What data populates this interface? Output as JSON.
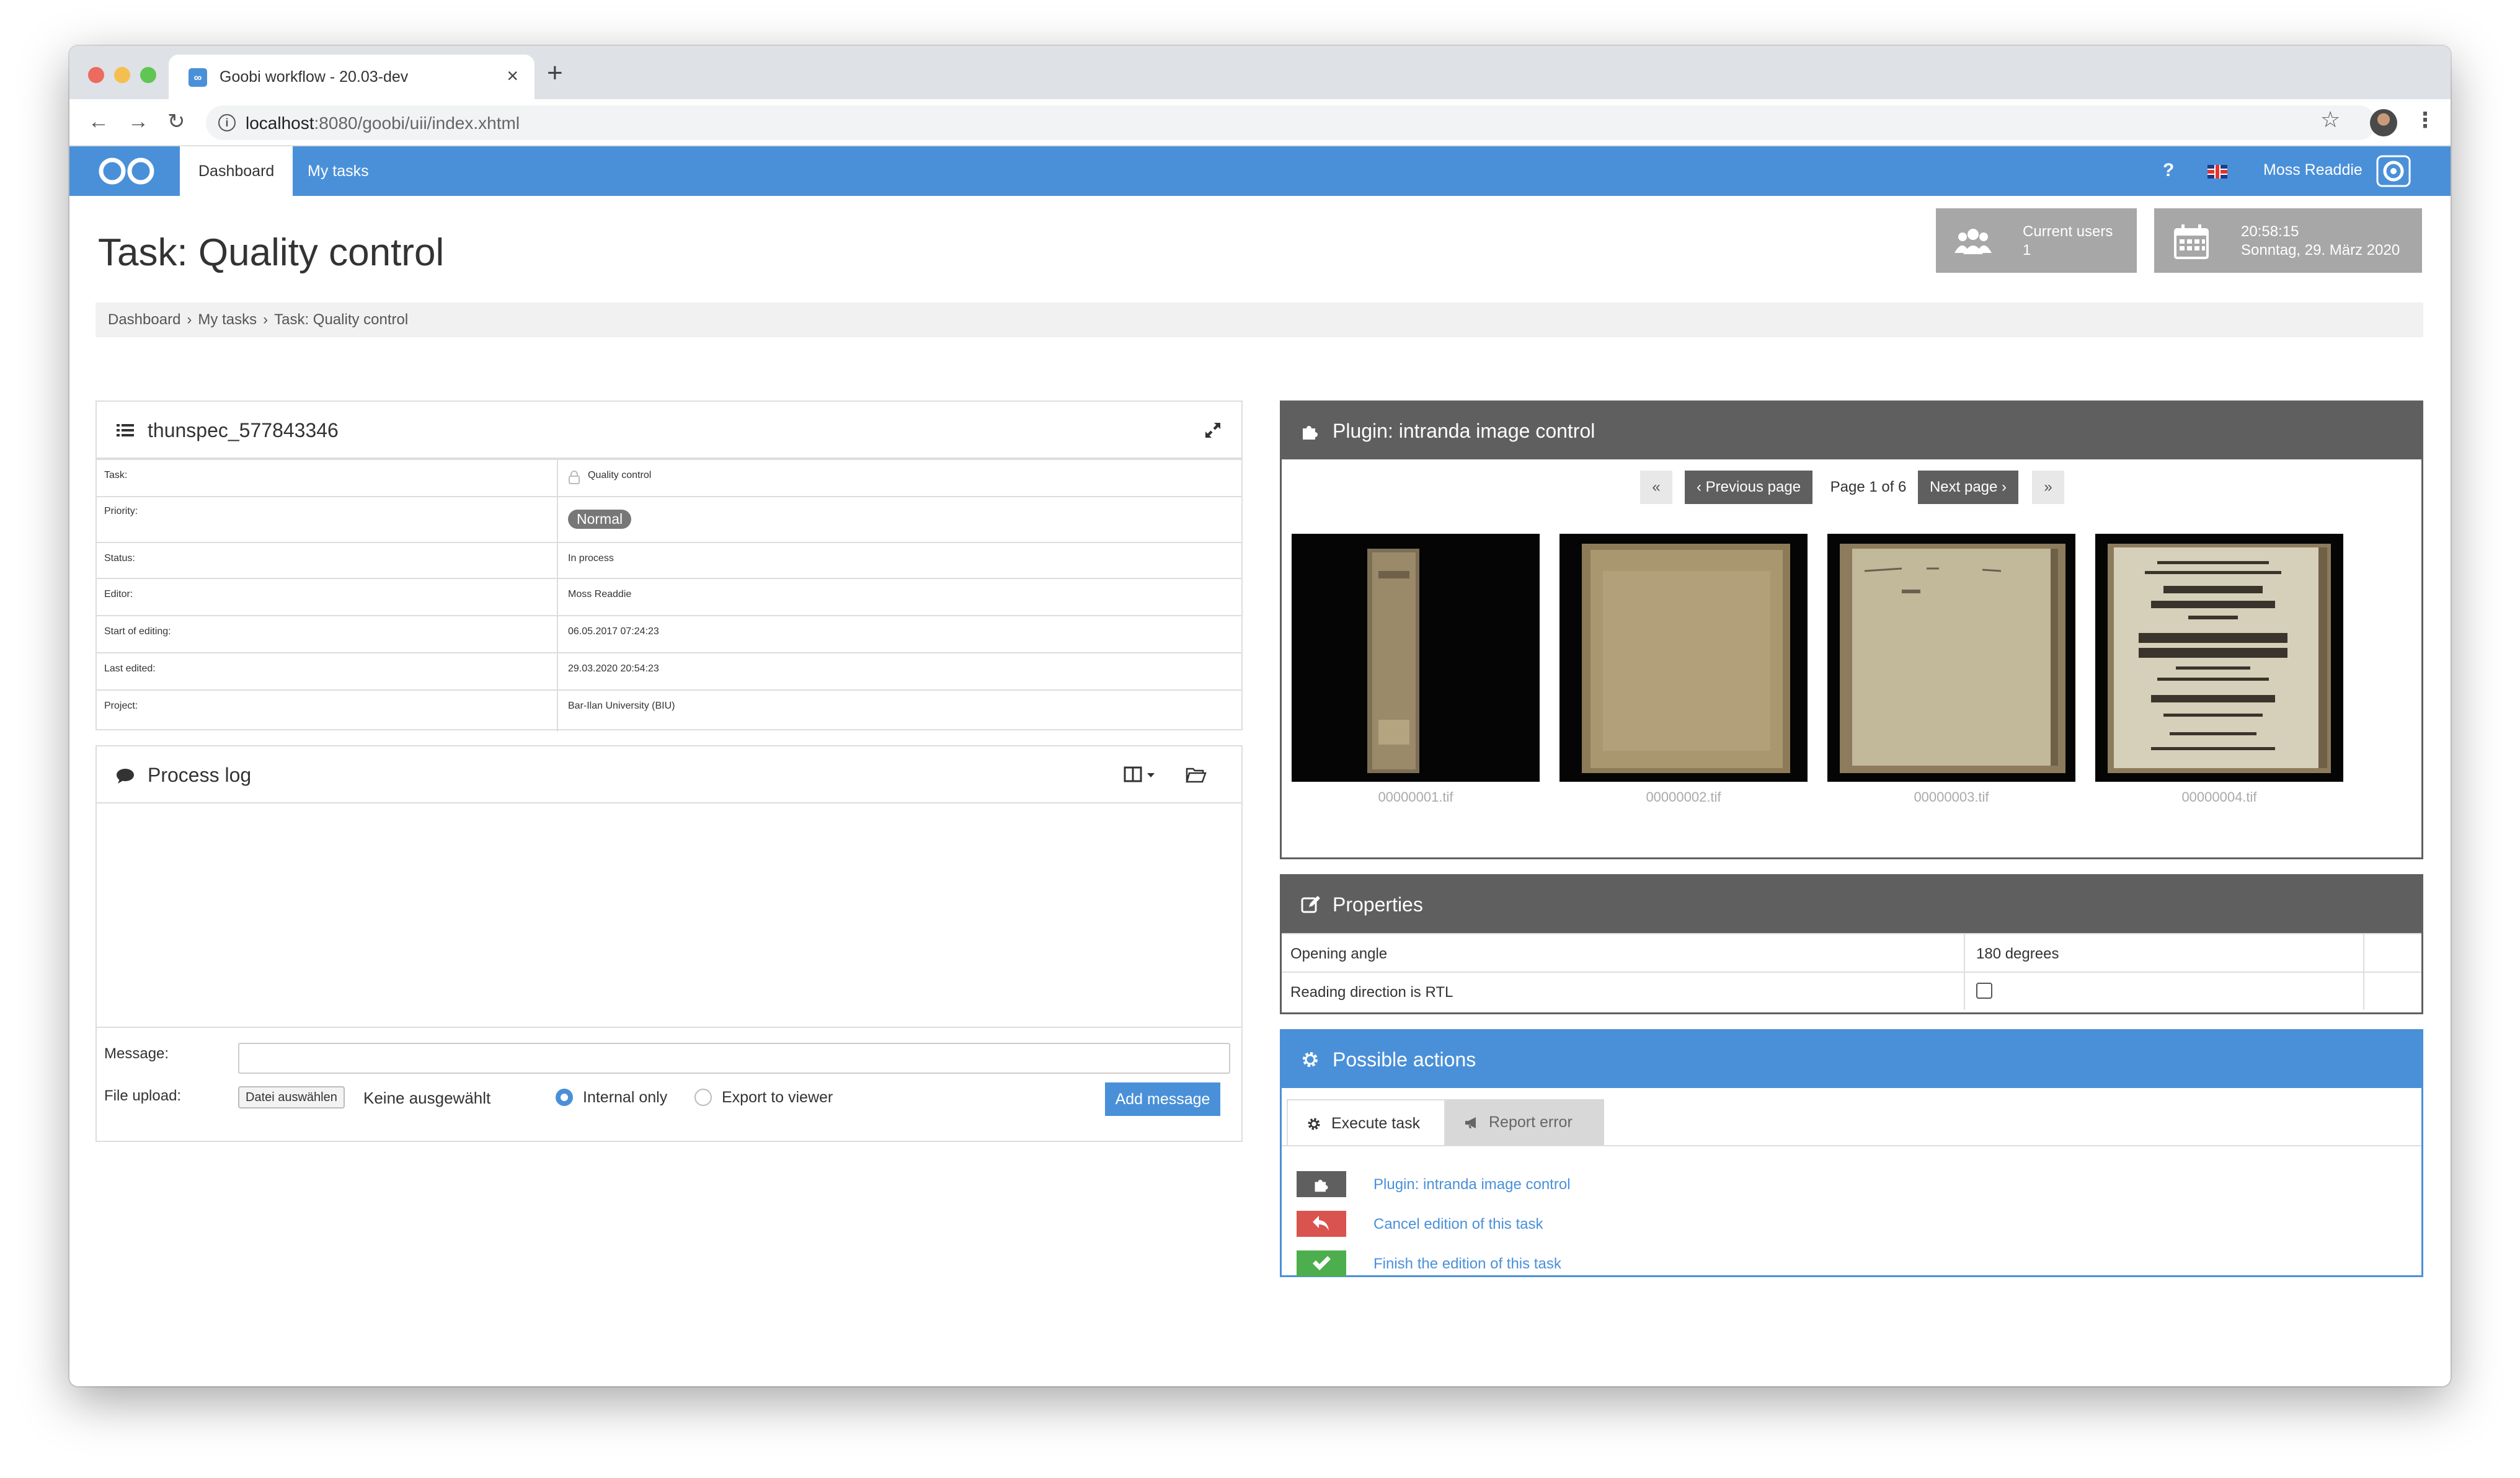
{
  "browser": {
    "tab_title": "Goobi workflow - 20.03-dev",
    "tab_favicon_text": "∞",
    "tab_close": "×",
    "new_tab": "+",
    "url_host": "localhost",
    "url_rest": ":8080/goobi/uii/index.xhtml"
  },
  "nav": {
    "tabs": [
      {
        "label": "Dashboard",
        "active": true
      },
      {
        "label": "My tasks",
        "active": false
      }
    ],
    "help": "?",
    "user": "Moss Readdie",
    "brand_color": "#4a90d9"
  },
  "header": {
    "title": "Task: Quality control",
    "users_box": {
      "line1": "Current users",
      "line2": "1"
    },
    "date_box": {
      "line1": "20:58:15",
      "line2": "Sonntag, 29. März 2020"
    }
  },
  "breadcrumb": [
    "Dashboard",
    "My tasks",
    "Task: Quality control"
  ],
  "details": {
    "title": "thunspec_577843346",
    "rows": [
      {
        "label": "Task:",
        "value": "Quality control"
      },
      {
        "label": "Priority:",
        "value": "Normal"
      },
      {
        "label": "Status:",
        "value": "In process"
      },
      {
        "label": "Editor:",
        "value": "Moss Readdie"
      },
      {
        "label": "Start of editing:",
        "value": "06.05.2017 07:24:23"
      },
      {
        "label": "Last edited:",
        "value": "29.03.2020 20:54:23"
      },
      {
        "label": "Project:",
        "value": "Bar-Ilan University (BIU)"
      }
    ]
  },
  "process_log": {
    "title": "Process log",
    "message_label": "Message:",
    "message_value": "",
    "upload_label": "File upload:",
    "file_button": "Datei auswählen",
    "file_none": "Keine ausgewählt",
    "radio_internal": "Internal only",
    "radio_export": "Export to viewer",
    "selected": "internal",
    "add_button": "Add message"
  },
  "plugin": {
    "title": "Plugin: intranda image control",
    "first": "«",
    "prev": "‹ Previous page",
    "page_info": "Page 1 of 6",
    "next": "Next page ›",
    "last": "»",
    "images": [
      {
        "caption": "00000001.tif"
      },
      {
        "caption": "00000002.tif"
      },
      {
        "caption": "00000003.tif"
      },
      {
        "caption": "00000004.tif"
      }
    ]
  },
  "properties": {
    "title": "Properties",
    "rows": [
      {
        "label": "Opening angle",
        "value": "180 degrees"
      },
      {
        "label": "Reading direction is RTL",
        "value": "",
        "checked": false
      }
    ]
  },
  "actions": {
    "title": "Possible actions",
    "tabs": [
      {
        "label": "Execute task",
        "active": true
      },
      {
        "label": "Report error",
        "active": false
      }
    ],
    "items": [
      {
        "label": "Plugin: intranda image control",
        "color": "#5f5f5f"
      },
      {
        "label": "Cancel edition of this task",
        "color": "#d9534f"
      },
      {
        "label": "Finish the edition of this task",
        "color": "#4cae4c"
      }
    ]
  }
}
